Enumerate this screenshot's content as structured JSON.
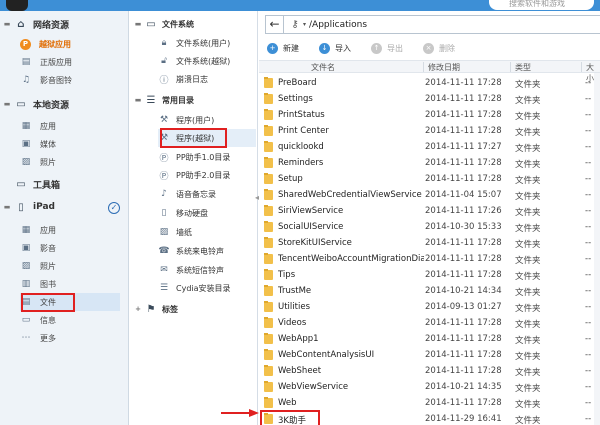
{
  "topbar": {
    "search_placeholder": "搜索软件和游戏"
  },
  "sidebar": {
    "network": {
      "label": "网络资源",
      "items": [
        {
          "label": "越狱应用",
          "icon": "pp-icon"
        },
        {
          "label": "正版应用",
          "icon": "store-icon"
        },
        {
          "label": "影音图铃",
          "icon": "music-icon"
        }
      ]
    },
    "local": {
      "label": "本地资源",
      "items": [
        {
          "label": "应用",
          "icon": "apps-icon"
        },
        {
          "label": "媒体",
          "icon": "media-icon"
        },
        {
          "label": "照片",
          "icon": "photo-icon"
        }
      ]
    },
    "toolbox": {
      "label": "工具箱"
    },
    "ipad": {
      "label": "iPad",
      "items": [
        {
          "label": "应用",
          "icon": "apps-icon"
        },
        {
          "label": "影音",
          "icon": "media-icon"
        },
        {
          "label": "照片",
          "icon": "photo-icon"
        },
        {
          "label": "图书",
          "icon": "book-icon"
        },
        {
          "label": "文件",
          "icon": "file-icon"
        },
        {
          "label": "信息",
          "icon": "message-icon"
        },
        {
          "label": "更多",
          "icon": "more-icon"
        }
      ]
    }
  },
  "middle": {
    "filesystem": {
      "label": "文件系统",
      "items": [
        {
          "label": "文件系统(用户)",
          "icon": "lock-icon"
        },
        {
          "label": "文件系统(越狱)",
          "icon": "unlock-icon"
        },
        {
          "label": "崩溃日志",
          "icon": "alert-icon"
        }
      ]
    },
    "common": {
      "label": "常用目录",
      "items": [
        {
          "label": "程序(用户)",
          "icon": "program-icon"
        },
        {
          "label": "程序(越狱)",
          "icon": "program-icon"
        },
        {
          "label": "PP助手1.0目录",
          "icon": "pp-icon"
        },
        {
          "label": "PP助手2.0目录",
          "icon": "pp-icon"
        },
        {
          "label": "语音备忘录",
          "icon": "mic-icon"
        },
        {
          "label": "移动硬盘",
          "icon": "disk-icon"
        },
        {
          "label": "墙纸",
          "icon": "wallpaper-icon"
        },
        {
          "label": "系统来电铃声",
          "icon": "ringtone-icon"
        },
        {
          "label": "系统短信铃声",
          "icon": "sms-icon"
        },
        {
          "label": "Cydia安装目录",
          "icon": "list-icon"
        }
      ]
    },
    "tags": {
      "label": "标签"
    }
  },
  "address": {
    "path": "/Applications"
  },
  "toolbar": {
    "new_label": "新建",
    "import_label": "导入",
    "export_label": "导出",
    "delete_label": "删除"
  },
  "table": {
    "columns": [
      "文件名",
      "修改日期",
      "类型",
      "大小"
    ],
    "rows": [
      {
        "name": "PreBoard",
        "date": "2014-11-11 17:28",
        "type": "文件夹",
        "size": "--"
      },
      {
        "name": "Settings",
        "date": "2014-11-11 17:28",
        "type": "文件夹",
        "size": "--"
      },
      {
        "name": "PrintStatus",
        "date": "2014-11-11 17:28",
        "type": "文件夹",
        "size": "--"
      },
      {
        "name": "Print Center",
        "date": "2014-11-11 17:28",
        "type": "文件夹",
        "size": "--"
      },
      {
        "name": "quicklookd",
        "date": "2014-11-11 17:27",
        "type": "文件夹",
        "size": "--"
      },
      {
        "name": "Reminders",
        "date": "2014-11-11 17:28",
        "type": "文件夹",
        "size": "--"
      },
      {
        "name": "Setup",
        "date": "2014-11-11 17:28",
        "type": "文件夹",
        "size": "--"
      },
      {
        "name": "SharedWebCredentialViewService",
        "date": "2014-11-04 15:07",
        "type": "文件夹",
        "size": "--"
      },
      {
        "name": "SiriViewService",
        "date": "2014-11-11 17:26",
        "type": "文件夹",
        "size": "--"
      },
      {
        "name": "SocialUIService",
        "date": "2014-10-30 15:33",
        "type": "文件夹",
        "size": "--"
      },
      {
        "name": "StoreKitUIService",
        "date": "2014-11-11 17:28",
        "type": "文件夹",
        "size": "--"
      },
      {
        "name": "TencentWeiboAccountMigrationDia...",
        "date": "2014-11-11 17:28",
        "type": "文件夹",
        "size": "--"
      },
      {
        "name": "Tips",
        "date": "2014-11-11 17:28",
        "type": "文件夹",
        "size": "--"
      },
      {
        "name": "TrustMe",
        "date": "2014-10-21 14:34",
        "type": "文件夹",
        "size": "--"
      },
      {
        "name": "Utilities",
        "date": "2014-09-13 01:27",
        "type": "文件夹",
        "size": "--"
      },
      {
        "name": "Videos",
        "date": "2014-11-11 17:28",
        "type": "文件夹",
        "size": "--"
      },
      {
        "name": "WebApp1",
        "date": "2014-11-11 17:28",
        "type": "文件夹",
        "size": "--"
      },
      {
        "name": "WebContentAnalysisUI",
        "date": "2014-11-11 17:28",
        "type": "文件夹",
        "size": "--"
      },
      {
        "name": "WebSheet",
        "date": "2014-11-11 17:28",
        "type": "文件夹",
        "size": "--"
      },
      {
        "name": "WebViewService",
        "date": "2014-10-21 14:35",
        "type": "文件夹",
        "size": "--"
      },
      {
        "name": "Web",
        "date": "2014-11-11 17:28",
        "type": "文件夹",
        "size": "--"
      },
      {
        "name": "3K助手",
        "date": "2014-11-29 16:41",
        "type": "文件夹",
        "size": "--"
      }
    ]
  },
  "colors": {
    "accent": "#3d8fd6",
    "highlight": "#e02020",
    "orange": "#e06b00",
    "folder": "#f2c04a"
  }
}
